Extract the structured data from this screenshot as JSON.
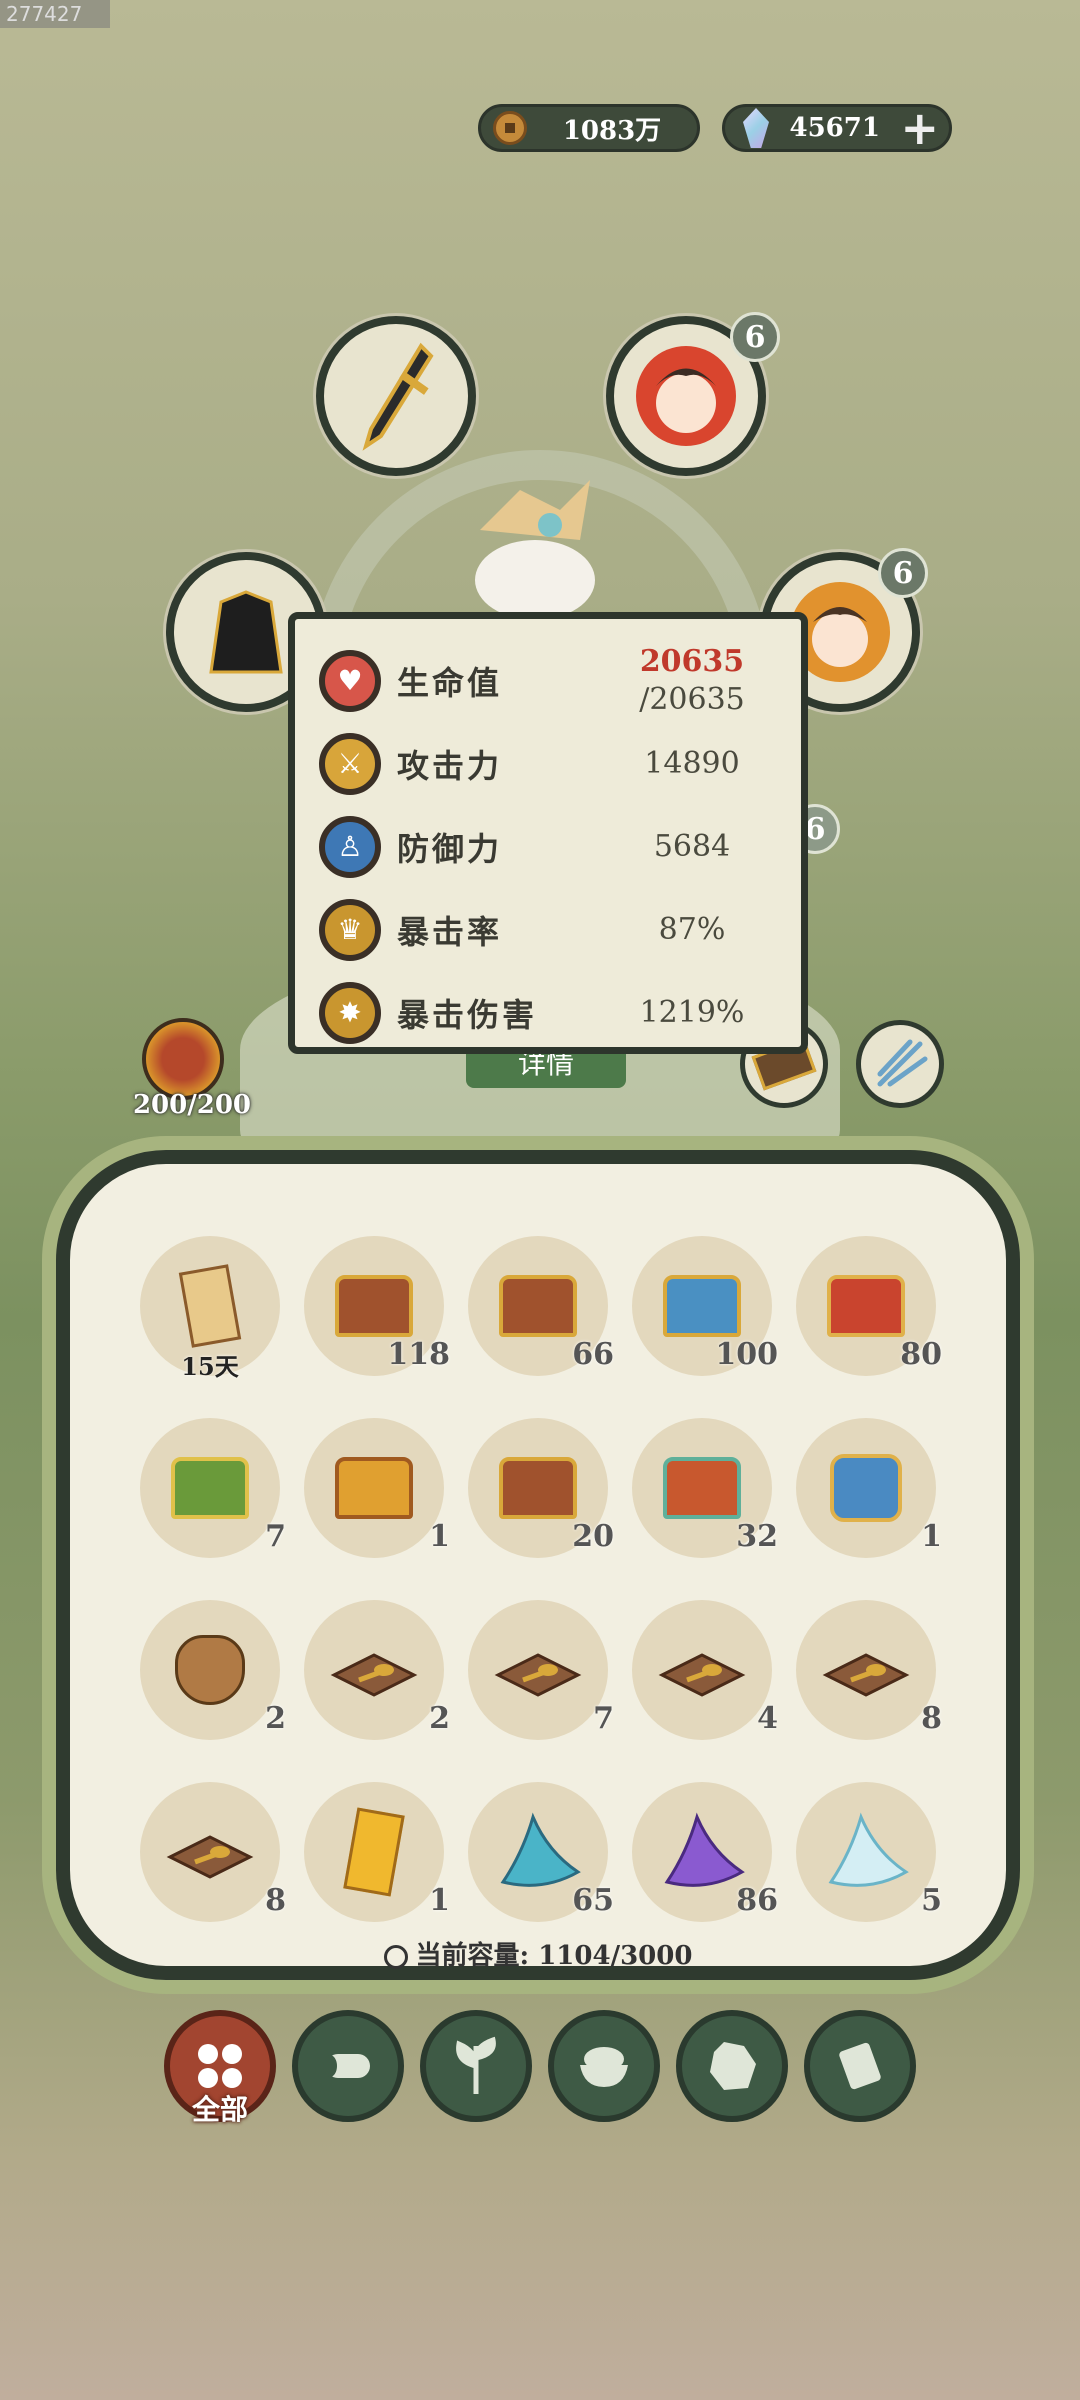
{
  "build_id": "277427",
  "currency": {
    "coins": "1083万",
    "gems": "45671",
    "add": "+"
  },
  "equipment": {
    "slot_badges": [
      "6",
      "6",
      "6"
    ]
  },
  "stats": [
    {
      "label": "生命值",
      "value": "20635",
      "max": "/20635",
      "icon": "heart-icon",
      "color": "#d7564a"
    },
    {
      "label": "攻击力",
      "value": "14890",
      "icon": "sword-icon",
      "color": "#d8a53a"
    },
    {
      "label": "防御力",
      "value": "5684",
      "icon": "person-icon",
      "color": "#3e78b5"
    },
    {
      "label": "暴击率",
      "value": "87%",
      "icon": "crown-icon",
      "color": "#c9962f"
    },
    {
      "label": "暴击伤害",
      "value": "1219%",
      "icon": "burst-icon",
      "color": "#c9962f"
    }
  ],
  "energy": "200/200",
  "detail_button": "详情",
  "inventory": {
    "items": [
      {
        "icon": "scroll-icon",
        "count": "15天"
      },
      {
        "icon": "chest-icon",
        "count": "118"
      },
      {
        "icon": "chest-icon",
        "count": "66"
      },
      {
        "icon": "blue-chest-icon",
        "count": "100"
      },
      {
        "icon": "red-chest-icon",
        "count": "80"
      },
      {
        "icon": "green-chest-icon",
        "count": "7"
      },
      {
        "icon": "gold-chest-icon",
        "count": "1"
      },
      {
        "icon": "chest-icon",
        "count": "20"
      },
      {
        "icon": "jade-chest-icon",
        "count": "32"
      },
      {
        "icon": "gift-bag-icon",
        "count": "1"
      },
      {
        "icon": "pouch-icon",
        "count": "2"
      },
      {
        "icon": "spoon-plate-icon",
        "count": "2"
      },
      {
        "icon": "spoon-plate-icon",
        "count": "7"
      },
      {
        "icon": "spoon-plate-icon",
        "count": "4"
      },
      {
        "icon": "spoon-plate-icon",
        "count": "8"
      },
      {
        "icon": "spoon-plate-icon",
        "count": "8"
      },
      {
        "icon": "talisman-icon",
        "count": "1"
      },
      {
        "icon": "fish-icon",
        "count": "65"
      },
      {
        "icon": "purple-fish-icon",
        "count": "86"
      },
      {
        "icon": "white-fish-icon",
        "count": "5"
      }
    ],
    "capacity_label": "当前容量:",
    "capacity_value": "1104/3000"
  },
  "tabs": [
    {
      "label": "全部",
      "icon": "grid-icon"
    },
    {
      "icon": "log-icon"
    },
    {
      "icon": "herb-icon"
    },
    {
      "icon": "bowl-icon"
    },
    {
      "icon": "ore-icon"
    },
    {
      "icon": "scroll-icon"
    }
  ]
}
